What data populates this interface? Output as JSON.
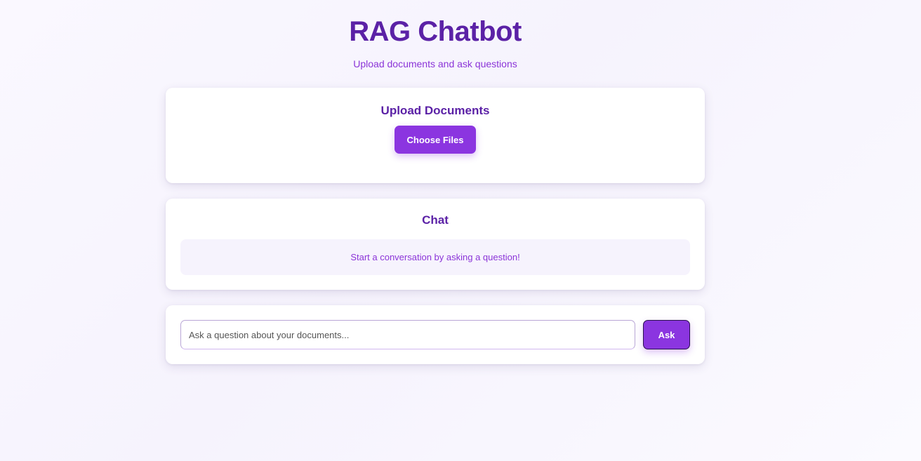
{
  "header": {
    "title": "RAG Chatbot",
    "subtitle": "Upload documents and ask questions"
  },
  "upload": {
    "title": "Upload Documents",
    "button_label": "Choose Files"
  },
  "chat": {
    "title": "Chat",
    "empty_message": "Start a conversation by asking a question!"
  },
  "ask": {
    "input_value": "",
    "input_placeholder": "Ask a question about your documents...",
    "button_label": "Ask"
  },
  "colors": {
    "accent": "#8b35e0",
    "title": "#5b21a6",
    "muted_text": "#8b34d8",
    "chat_box_bg": "#f6f3fd"
  }
}
